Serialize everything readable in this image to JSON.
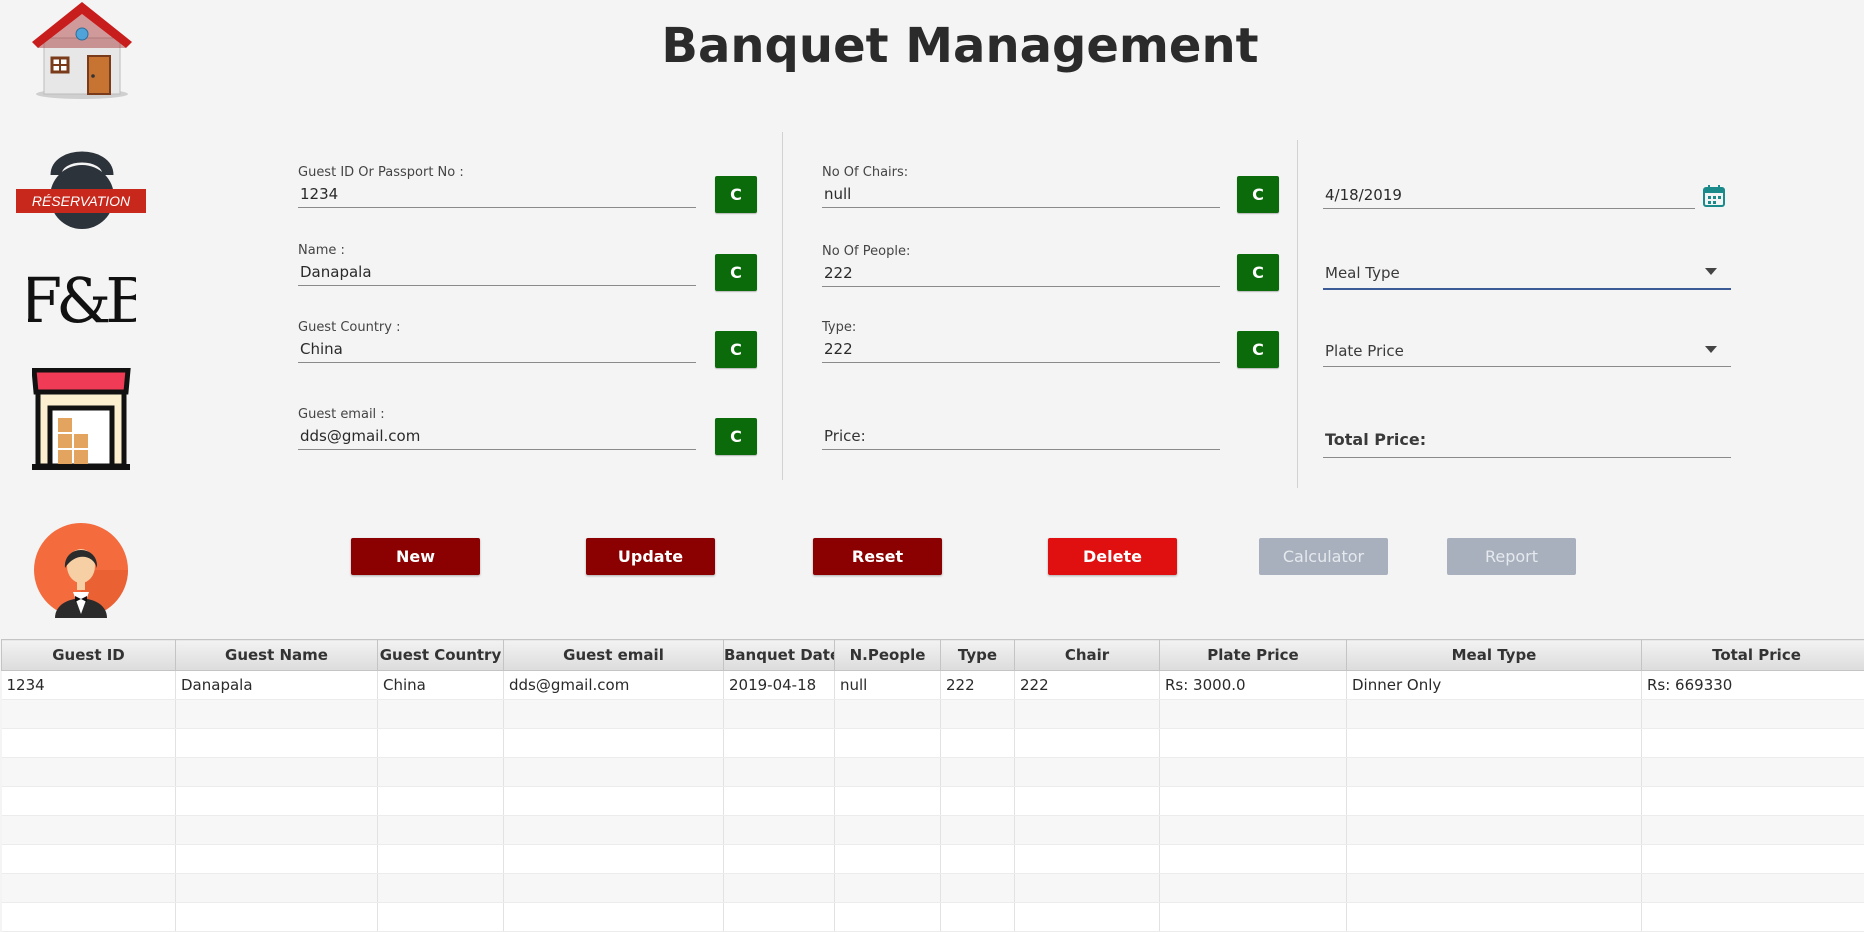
{
  "app": {
    "title": "Banquet Management"
  },
  "sidebar": {
    "items": [
      {
        "name": "home",
        "icon": "home-icon"
      },
      {
        "name": "reservation",
        "icon": "kettlebell-icon",
        "label": "RÉSERVATION"
      },
      {
        "name": "fnb",
        "icon": "fnb-logo-icon",
        "label": "F&B"
      },
      {
        "name": "store",
        "icon": "store-icon"
      },
      {
        "name": "profile",
        "icon": "waiter-avatar-icon"
      }
    ]
  },
  "form": {
    "guest_id": {
      "label": "Guest ID Or Passport No :",
      "value": "1234"
    },
    "name": {
      "label": "Name :",
      "value": "Danapala"
    },
    "country": {
      "label": "Guest Country :",
      "value": "China"
    },
    "email": {
      "label": "Guest email :",
      "value": "dds@gmail.com"
    },
    "chairs": {
      "label": "No Of Chairs:",
      "value": "null"
    },
    "people": {
      "label": "No Of People:",
      "value": "222"
    },
    "type": {
      "label": "Type:",
      "value": "222"
    },
    "price": {
      "placeholder": "Price:"
    },
    "date": {
      "value": "4/18/2019"
    },
    "meal_type": {
      "placeholder": "Meal Type"
    },
    "plate_price": {
      "placeholder": "Plate Price"
    },
    "total_price": {
      "label": "Total Price:"
    },
    "clear_label": "C"
  },
  "actions": {
    "new": "New",
    "update": "Update",
    "reset": "Reset",
    "delete": "Delete",
    "calculator": "Calculator",
    "report": "Report"
  },
  "colors": {
    "clear_button": "#0b6b0b",
    "action_dark": "#8b0000",
    "action_delete": "#e01010",
    "action_disabled": "#a7b0bc",
    "focus_underline": "#3a5b96"
  },
  "table": {
    "columns": [
      "Guest ID",
      "Guest Name",
      "Guest Country",
      "Guest email",
      "Banquet Date",
      "N.People",
      "Type",
      "Chair",
      "Plate Price",
      "Meal Type",
      "Total Price"
    ],
    "rows": [
      [
        "1234",
        "Danapala",
        "China",
        "dds@gmail.com",
        "2019-04-18",
        "null",
        "222",
        "222",
        "Rs: 3000.0",
        "Dinner Only",
        "Rs: 669330"
      ]
    ]
  }
}
